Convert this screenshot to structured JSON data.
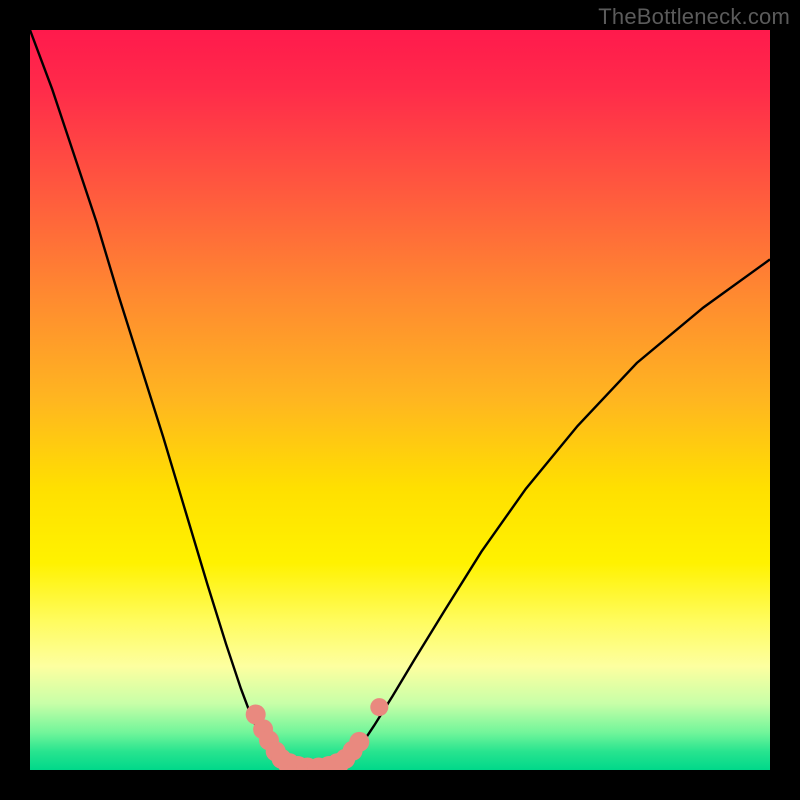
{
  "watermark": "TheBottleneck.com",
  "chart_data": {
    "type": "line",
    "title": "",
    "xlabel": "",
    "ylabel": "",
    "xlim": [
      0,
      1
    ],
    "ylim": [
      0,
      1
    ],
    "series": [
      {
        "name": "curve-left",
        "x": [
          0.0,
          0.03,
          0.06,
          0.09,
          0.12,
          0.15,
          0.18,
          0.21,
          0.24,
          0.265,
          0.285,
          0.3,
          0.315,
          0.33,
          0.34,
          0.35
        ],
        "y": [
          1.0,
          0.92,
          0.83,
          0.74,
          0.64,
          0.545,
          0.45,
          0.35,
          0.25,
          0.17,
          0.11,
          0.07,
          0.04,
          0.015,
          0.005,
          0.0
        ]
      },
      {
        "name": "curve-right",
        "x": [
          0.42,
          0.43,
          0.445,
          0.465,
          0.49,
          0.52,
          0.56,
          0.61,
          0.67,
          0.74,
          0.82,
          0.91,
          1.0
        ],
        "y": [
          0.0,
          0.01,
          0.03,
          0.06,
          0.1,
          0.15,
          0.215,
          0.295,
          0.38,
          0.465,
          0.55,
          0.625,
          0.69
        ]
      },
      {
        "name": "floor",
        "x": [
          0.35,
          0.42
        ],
        "y": [
          0.0,
          0.0
        ]
      }
    ],
    "marker_points": {
      "name": "highlight-dots",
      "color": "#e9897f",
      "points": [
        {
          "x": 0.305,
          "y": 0.075,
          "r": 10
        },
        {
          "x": 0.315,
          "y": 0.055,
          "r": 10
        },
        {
          "x": 0.323,
          "y": 0.04,
          "r": 10
        },
        {
          "x": 0.332,
          "y": 0.025,
          "r": 10
        },
        {
          "x": 0.34,
          "y": 0.015,
          "r": 10
        },
        {
          "x": 0.35,
          "y": 0.008,
          "r": 11
        },
        {
          "x": 0.362,
          "y": 0.004,
          "r": 11
        },
        {
          "x": 0.375,
          "y": 0.002,
          "r": 11
        },
        {
          "x": 0.39,
          "y": 0.002,
          "r": 11
        },
        {
          "x": 0.404,
          "y": 0.004,
          "r": 11
        },
        {
          "x": 0.416,
          "y": 0.008,
          "r": 11
        },
        {
          "x": 0.426,
          "y": 0.015,
          "r": 10
        },
        {
          "x": 0.436,
          "y": 0.026,
          "r": 10
        },
        {
          "x": 0.445,
          "y": 0.038,
          "r": 10
        },
        {
          "x": 0.472,
          "y": 0.085,
          "r": 9
        }
      ]
    },
    "background_gradient_stops": [
      {
        "pos": 0.0,
        "color": "#ff1a4c"
      },
      {
        "pos": 0.36,
        "color": "#ff8a30"
      },
      {
        "pos": 0.72,
        "color": "#fff200"
      },
      {
        "pos": 0.95,
        "color": "#70f59a"
      },
      {
        "pos": 1.0,
        "color": "#00d88a"
      }
    ]
  }
}
